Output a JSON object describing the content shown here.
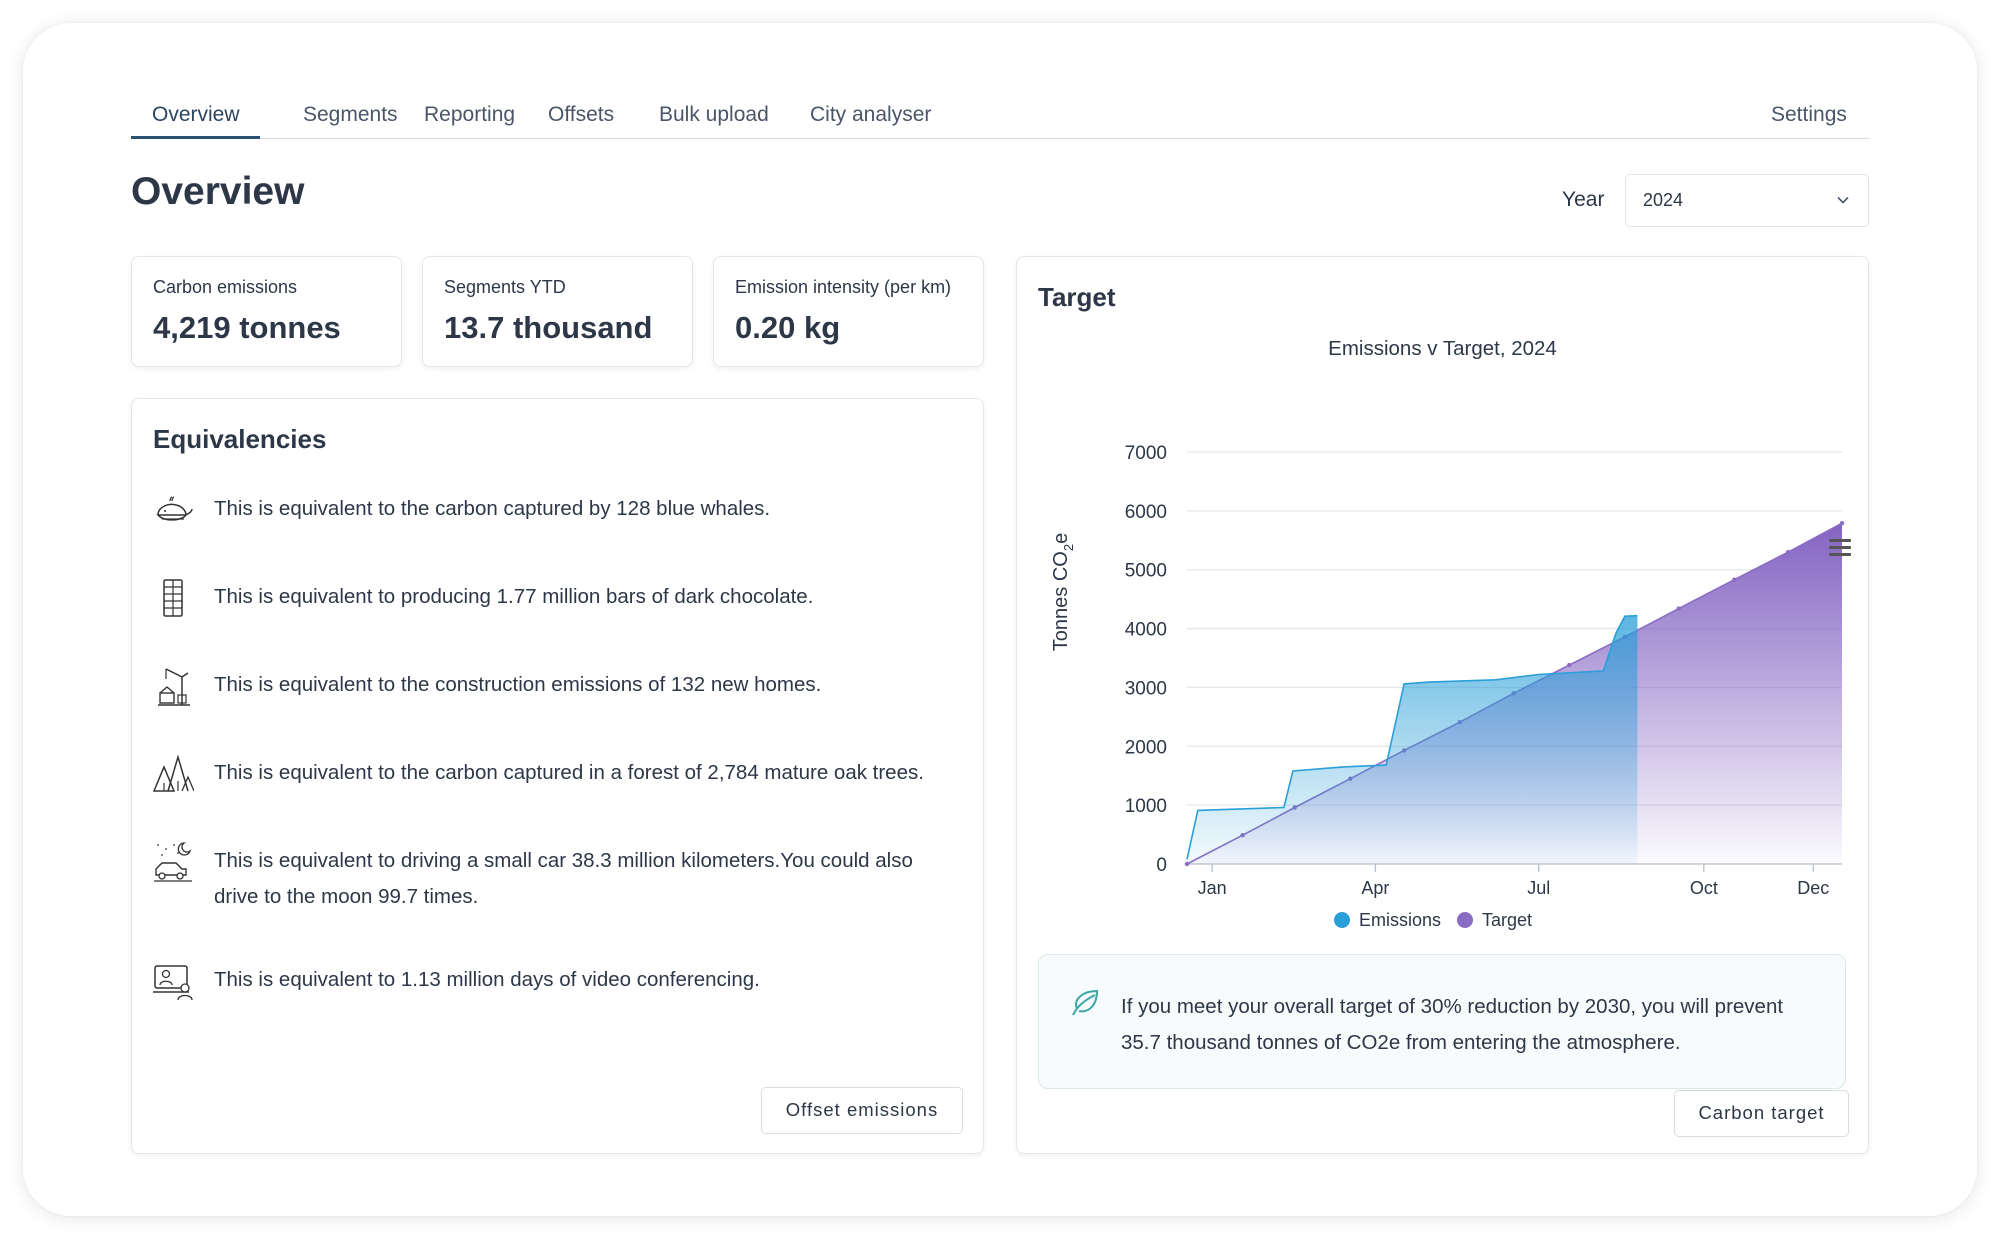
{
  "tabs": [
    "Overview",
    "Segments",
    "Reporting",
    "Offsets",
    "Bulk upload",
    "City analyser"
  ],
  "settings_label": "Settings",
  "page_title": "Overview",
  "year": {
    "label": "Year",
    "value": "2024"
  },
  "stats": [
    {
      "label": "Carbon emissions",
      "value": "4,219 tonnes"
    },
    {
      "label": "Segments YTD",
      "value": "13.7 thousand"
    },
    {
      "label": "Emission intensity (per km)",
      "value": "0.20 kg"
    }
  ],
  "equivalencies": {
    "title": "Equivalencies",
    "items": [
      {
        "icon": "whale-icon",
        "text": "This is equivalent to the carbon captured by 128 blue whales."
      },
      {
        "icon": "chocolate-bar-icon",
        "text": "This is equivalent to producing 1.77 million bars of dark chocolate."
      },
      {
        "icon": "construction-icon",
        "text": "This is equivalent to the construction emissions of 132 new homes."
      },
      {
        "icon": "forest-icon",
        "text": "This is equivalent to the carbon captured in a forest of 2,784 mature oak trees."
      },
      {
        "icon": "car-moon-icon",
        "text": "This is equivalent to driving a small car 38.3 million kilometers.You could also drive to the moon 99.7 times."
      },
      {
        "icon": "video-conference-icon",
        "text": "This is equivalent to 1.13 million days of video conferencing."
      }
    ],
    "button": "Offset emissions"
  },
  "target": {
    "title": "Target",
    "info_text": "If you meet your overall target of 30% reduction by 2030, you will prevent 35.7 thousand tonnes of CO2e from entering the atmosphere.",
    "info_icon": "leaf-icon",
    "button": "Carbon target"
  },
  "chart_data": {
    "type": "area",
    "title": "Emissions v Target, 2024",
    "ylabel_main": "Tonnes CO",
    "ylabel_sub": "2",
    "ylabel_tail": "e",
    "ylim": [
      0,
      7000
    ],
    "yticks": [
      0,
      1000,
      2000,
      3000,
      4000,
      5000,
      6000,
      7000
    ],
    "xticks": [
      {
        "label": "Jan",
        "x": "2024-01-15"
      },
      {
        "label": "Apr",
        "x": "2024-04-15"
      },
      {
        "label": "Jul",
        "x": "2024-07-15"
      },
      {
        "label": "Oct",
        "x": "2024-10-15"
      },
      {
        "label": "Dec",
        "x": "2024-12-15"
      }
    ],
    "x_range": [
      "2024-01-01",
      "2024-12-31"
    ],
    "grid": true,
    "legend_position": "bottom",
    "series": [
      {
        "name": "Emissions",
        "color": "#2a9fd8",
        "points": [
          [
            "2024-01-01",
            80
          ],
          [
            "2024-01-07",
            910
          ],
          [
            "2024-02-24",
            960
          ],
          [
            "2024-02-29",
            1580
          ],
          [
            "2024-03-28",
            1650
          ],
          [
            "2024-04-21",
            1680
          ],
          [
            "2024-05-01",
            3060
          ],
          [
            "2024-05-15",
            3090
          ],
          [
            "2024-06-21",
            3130
          ],
          [
            "2024-07-15",
            3220
          ],
          [
            "2024-08-20",
            3280
          ],
          [
            "2024-08-27",
            3920
          ],
          [
            "2024-09-01",
            4210
          ],
          [
            "2024-09-08",
            4219
          ]
        ]
      },
      {
        "name": "Target",
        "color": "#8b6cc4",
        "points": [
          [
            "2024-01-01",
            0
          ],
          [
            "2024-02-01",
            490
          ],
          [
            "2024-03-01",
            960
          ],
          [
            "2024-04-01",
            1450
          ],
          [
            "2024-05-01",
            1930
          ],
          [
            "2024-06-01",
            2410
          ],
          [
            "2024-07-01",
            2900
          ],
          [
            "2024-08-01",
            3380
          ],
          [
            "2024-09-01",
            3860
          ],
          [
            "2024-10-01",
            4340
          ],
          [
            "2024-11-01",
            4830
          ],
          [
            "2024-12-01",
            5300
          ],
          [
            "2024-12-31",
            5790
          ]
        ]
      }
    ]
  },
  "menu_icon": "hamburger-menu-icon"
}
